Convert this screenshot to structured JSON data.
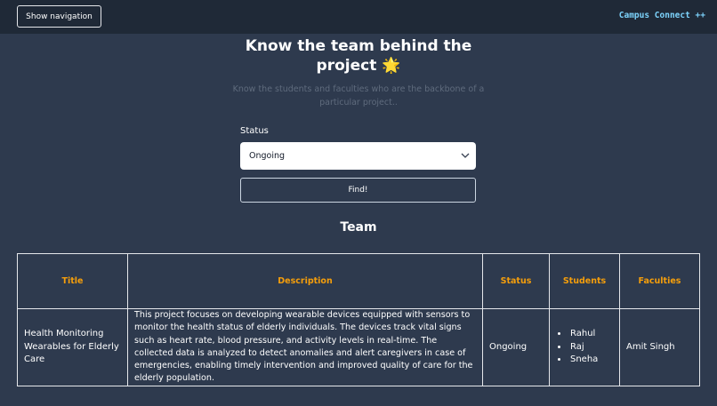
{
  "header": {
    "nav_button_label": "Show navigation",
    "brand": "Campus Connect ++"
  },
  "hero": {
    "title": "Know the team behind the project",
    "title_emoji": "🌟",
    "subtitle": "Know the students and faculties who are the backbone of a particular project.."
  },
  "filter": {
    "status_label": "Status",
    "selected_status": "Ongoing",
    "find_label": "Find!"
  },
  "team": {
    "heading": "Team",
    "columns": [
      "Title",
      "Description",
      "Status",
      "Students",
      "Faculties"
    ],
    "rows": [
      {
        "title": "Health Monitoring Wearables for Elderly Care",
        "description": "This project focuses on developing wearable devices equipped with sensors to monitor the health status of elderly individuals. The devices track vital signs such as heart rate, blood pressure, and activity levels in real-time. The collected data is analyzed to detect anomalies and alert caregivers in case of emergencies, enabling timely intervention and improved quality of care for the elderly population.",
        "status": "Ongoing",
        "students": [
          "Rahul",
          "Raj",
          "Sneha"
        ],
        "faculties": "Amit Singh"
      }
    ]
  },
  "colors": {
    "background": "#2e3a4e",
    "topbar": "#1f2937",
    "brand": "#7dd3fc",
    "table_header": "#f59e0b"
  },
  "icons": {
    "select_chevron": "chevron-down-icon",
    "title_emoji": "star-emoji"
  }
}
